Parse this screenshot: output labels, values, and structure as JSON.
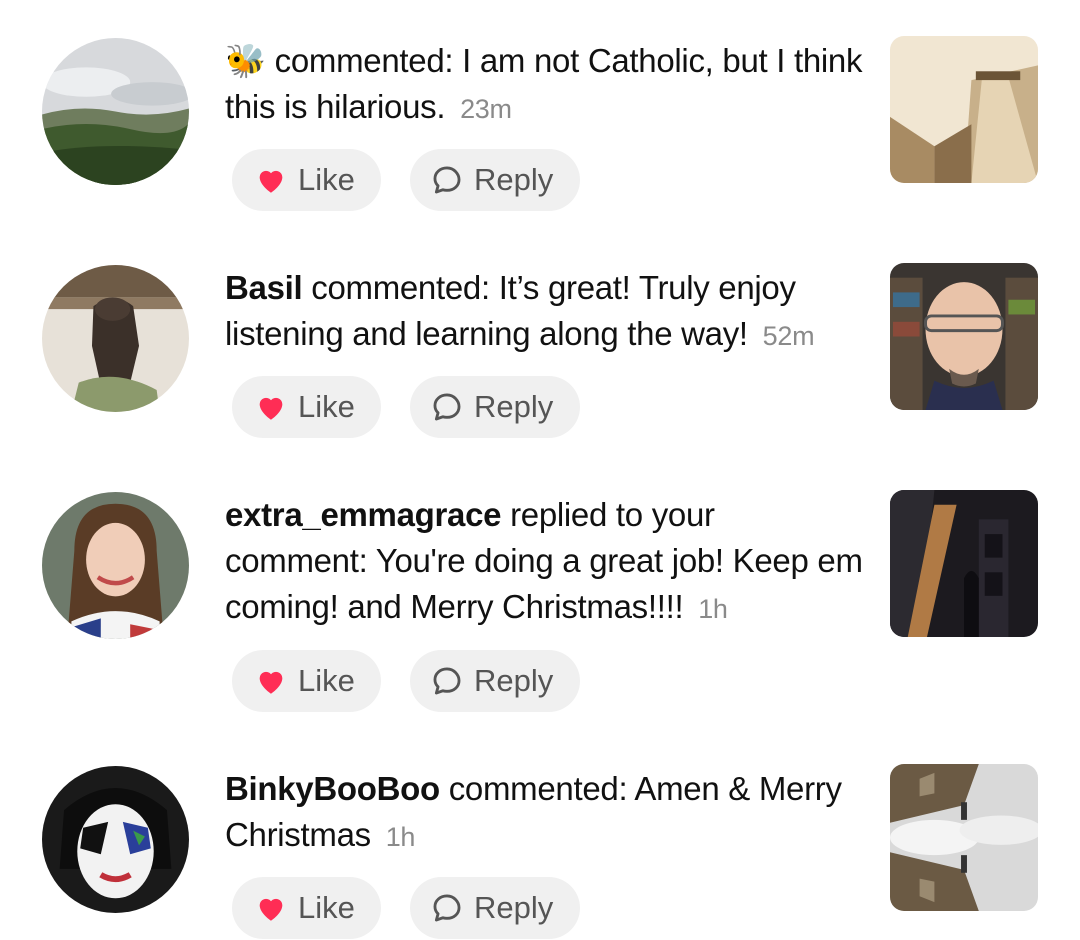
{
  "accent": {
    "like_heart": "#ff2d55",
    "time_gray": "#8a8a8a",
    "button_bg": "#f0f0f0"
  },
  "notifications": [
    {
      "avatar": "landscape-hills-avatar",
      "user": "",
      "user_icon": "bee-emoji",
      "bee": "🐝",
      "action": "commented:",
      "comment": "I am not Catholic, but I think this is hilarious.",
      "time": "23m",
      "like_label": "Like",
      "reply_label": "Reply",
      "thumbnail": "sepia-castle-wall-thumbnail"
    },
    {
      "avatar": "groundhog-statue-avatar",
      "user": "Basil",
      "action": "commented:",
      "comment": "It’s great! Truly enjoy listening and learning along the way!",
      "time": "52m",
      "like_label": "Like",
      "reply_label": "Reply",
      "thumbnail": "bald-man-glasses-thumbnail"
    },
    {
      "avatar": "smiling-girl-avatar",
      "user": "extra_emmagrace",
      "action": "replied to your comment:",
      "comment": "You're doing a great job! Keep em coming! and Merry Christmas!!!!",
      "time": "1h",
      "like_label": "Like",
      "reply_label": "Reply",
      "thumbnail": "dark-cathedral-thumbnail"
    },
    {
      "avatar": "kiss-facepaint-avatar",
      "user": "BinkyBooBoo",
      "action": "commented:",
      "comment": "Amen & Merry Christmas",
      "time": "1h",
      "like_label": "Like",
      "reply_label": "Reply",
      "thumbnail": "mirrored-church-spire-thumbnail"
    }
  ]
}
